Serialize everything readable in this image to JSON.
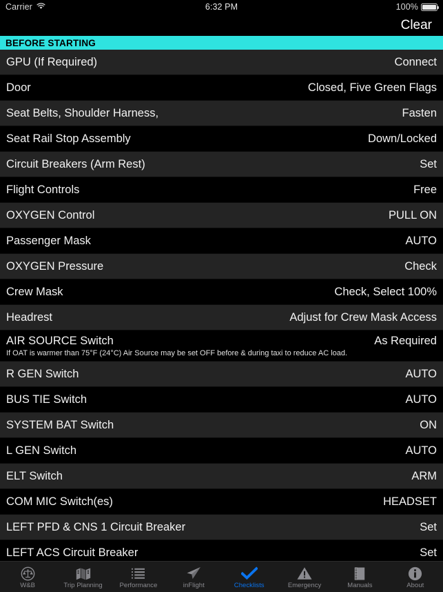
{
  "status_bar": {
    "carrier": "Carrier",
    "wifi_icon": "wifi-icon",
    "time": "6:32 PM",
    "battery_percent": "100%",
    "battery_icon": "battery-full-icon"
  },
  "nav_bar": {
    "clear_label": "Clear"
  },
  "section": {
    "title": "BEFORE STARTING",
    "background_color": "#2fe3e0",
    "text_color": "#000000"
  },
  "theme": {
    "row_odd_color": "#242424",
    "row_even_color": "#000000",
    "accent_active": "#0a74ef",
    "tab_inactive": "#8a8a8f",
    "tab_bar_background": "#1b1b1b"
  },
  "checklist": {
    "items": [
      {
        "title": "GPU (If Required)",
        "action": "Connect"
      },
      {
        "title": "Door",
        "action": "Closed, Five Green Flags"
      },
      {
        "title": "Seat Belts, Shoulder Harness,",
        "action": "Fasten"
      },
      {
        "title": "Seat Rail Stop Assembly",
        "action": "Down/Locked"
      },
      {
        "title": "Circuit Breakers (Arm Rest)",
        "action": "Set"
      },
      {
        "title": "Flight Controls",
        "action": "Free"
      },
      {
        "title": "OXYGEN Control",
        "action": "PULL ON"
      },
      {
        "title": "Passenger Mask",
        "action": "AUTO"
      },
      {
        "title": "OXYGEN Pressure",
        "action": "Check"
      },
      {
        "title": "Crew Mask",
        "action": "Check, Select 100%"
      },
      {
        "title": "Headrest",
        "action": "Adjust for Crew Mask Access"
      },
      {
        "title": "AIR SOURCE Switch",
        "action": "As Required",
        "note": "If OAT is warmer than 75°F (24°C) Air Source may be set OFF before & during taxi to reduce AC load."
      },
      {
        "title": "R GEN Switch",
        "action": "AUTO"
      },
      {
        "title": "BUS TIE Switch",
        "action": "AUTO"
      },
      {
        "title": "SYSTEM BAT Switch",
        "action": "ON"
      },
      {
        "title": "L GEN Switch",
        "action": "AUTO"
      },
      {
        "title": "ELT Switch",
        "action": "ARM"
      },
      {
        "title": "COM MIC Switch(es)",
        "action": "HEADSET"
      },
      {
        "title": "LEFT PFD & CNS 1 Circuit Breaker",
        "action": "Set"
      },
      {
        "title": "LEFT ACS Circuit Breaker",
        "action": "Set"
      }
    ]
  },
  "tab_bar": {
    "tabs": [
      {
        "label": "W&B",
        "icon": "scales-balance-icon",
        "active": false
      },
      {
        "label": "Trip Planning",
        "icon": "folded-map-icon",
        "active": false
      },
      {
        "label": "Performance",
        "icon": "list-lines-icon",
        "active": false
      },
      {
        "label": "inFlight",
        "icon": "paper-plane-icon",
        "active": false
      },
      {
        "label": "Checklists",
        "icon": "checkmark-icon",
        "active": true
      },
      {
        "label": "Emergency",
        "icon": "warning-triangle-icon",
        "active": false
      },
      {
        "label": "Manuals",
        "icon": "book-binder-icon",
        "active": false
      },
      {
        "label": "About",
        "icon": "info-circle-icon",
        "active": false
      }
    ]
  }
}
